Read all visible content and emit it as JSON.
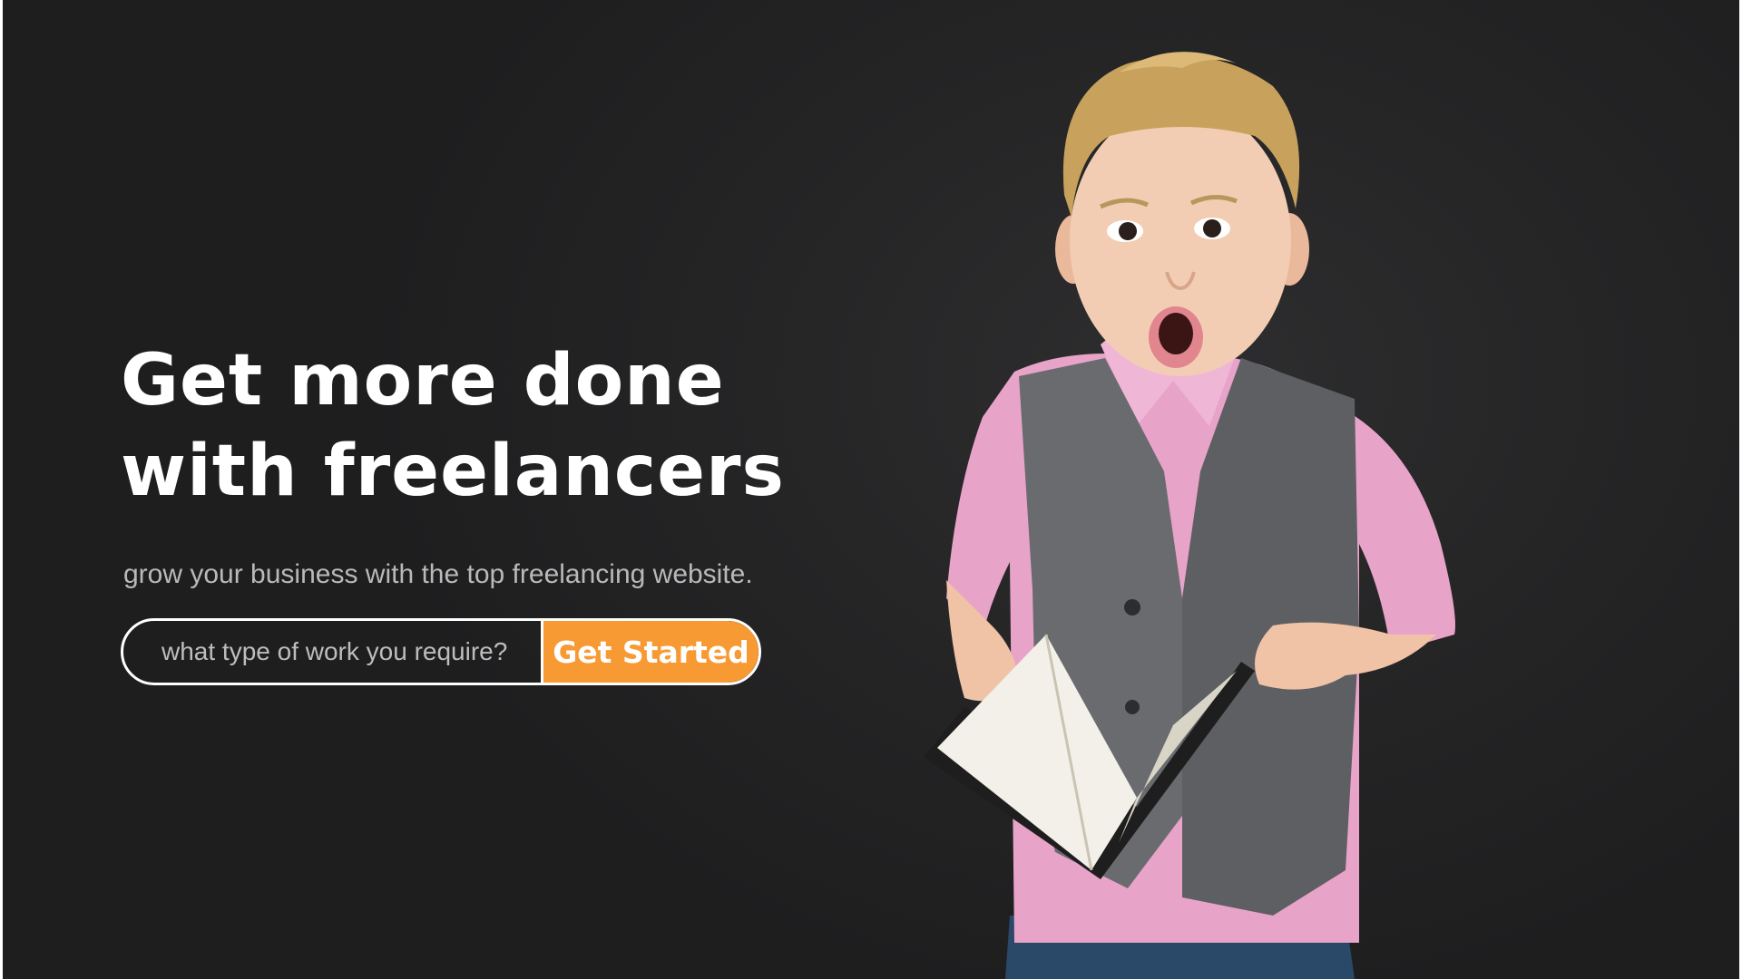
{
  "hero": {
    "headline_line1": "Get more done",
    "headline_line2": "with freelancers",
    "subline": "grow your business with the top freelancing website."
  },
  "search": {
    "placeholder": "what type of work you require?",
    "button_label": "Get Started"
  },
  "colors": {
    "background": "#262627",
    "accent": "#f79a33",
    "text": "#ffffff",
    "subtext": "#b9b9b9"
  },
  "photo": {
    "subject": "surprised-boy-with-book-icon"
  }
}
